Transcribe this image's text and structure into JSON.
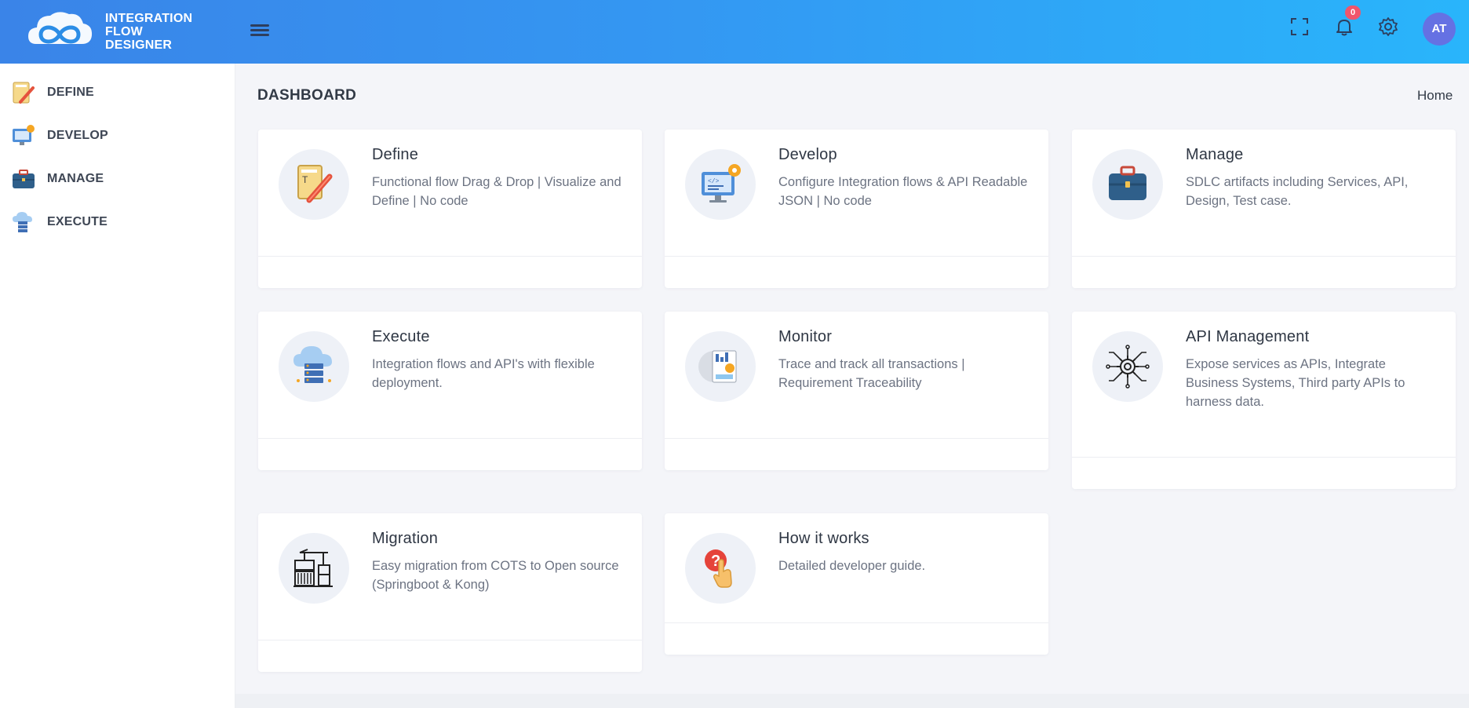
{
  "app": {
    "brand_line1": "INTEGRATION",
    "brand_line2": "FLOW",
    "brand_line3": "DESIGNER",
    "notification_count": "0",
    "user_initials": "AT",
    "colors": {
      "header_start": "#3a84e8",
      "header_end": "#29b5fb",
      "badge": "#f1556c",
      "avatar": "#6571e3"
    }
  },
  "sidebar": {
    "items": [
      {
        "label": "DEFINE",
        "icon": "define-icon"
      },
      {
        "label": "DEVELOP",
        "icon": "develop-icon"
      },
      {
        "label": "MANAGE",
        "icon": "briefcase-icon"
      },
      {
        "label": "EXECUTE",
        "icon": "cloud-server-icon"
      }
    ]
  },
  "page": {
    "title": "DASHBOARD",
    "breadcrumb": "Home"
  },
  "cards": [
    {
      "title": "Define",
      "description": "Functional flow Drag & Drop | Visualize and Define | No code",
      "icon": "define-icon"
    },
    {
      "title": "Develop",
      "description": "Configure Integration flows & API Readable JSON | No code",
      "icon": "develop-icon"
    },
    {
      "title": "Manage",
      "description": "SDLC artifacts including Services, API, Design, Test case.",
      "icon": "briefcase-icon"
    },
    {
      "title": "Execute",
      "description": "Integration flows and API's with flexible deployment.",
      "icon": "cloud-server-icon"
    },
    {
      "title": "Monitor",
      "description": "Trace and track all transactions | Requirement Traceability",
      "icon": "monitor-report-icon"
    },
    {
      "title": "API Management",
      "description": "Expose services as APIs, Integrate Business Systems, Third party APIs to harness data.",
      "icon": "api-gear-icon"
    },
    {
      "title": "Migration",
      "description": "Easy migration from COTS to Open source (Springboot & Kong)",
      "icon": "migration-crane-icon"
    },
    {
      "title": "How it works",
      "description": "Detailed developer guide.",
      "icon": "question-hand-icon"
    }
  ]
}
